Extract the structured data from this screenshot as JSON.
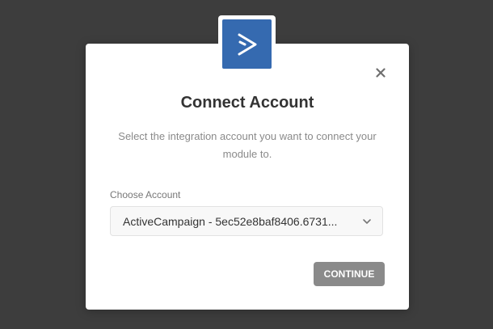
{
  "dialog": {
    "title": "Connect Account",
    "description": "Select the integration account you want to connect your module to.",
    "field_label": "Choose Account",
    "selected_account": "ActiveCampaign - 5ec52e8baf8406.6731...",
    "continue_label": "CONTINUE"
  },
  "icons": {
    "logo": "activecampaign-logo-icon",
    "close": "close-icon",
    "dropdown": "chevron-down-icon"
  },
  "colors": {
    "backdrop": "#3d3d3d",
    "brand": "#356ab0",
    "button": "#8a8a8a"
  }
}
